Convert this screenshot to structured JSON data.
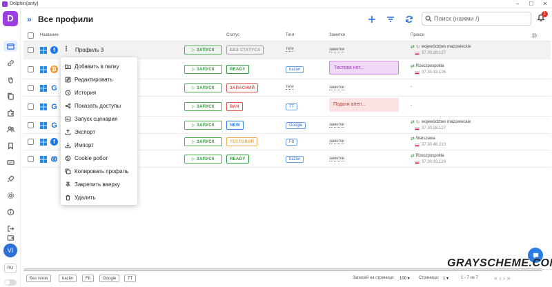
{
  "window": {
    "title": "Dolphin{anty}",
    "controls": [
      "–",
      "☐",
      "✕"
    ]
  },
  "sidebar": {
    "logo": "D",
    "avatar": "VI",
    "language": "RU"
  },
  "header": {
    "title": "Все профили",
    "search_placeholder": "Поиск (нажми /)",
    "notifications": "1"
  },
  "columns": {
    "name": "Название",
    "status": "Статус",
    "tags": "Теги",
    "notes": "Заметки",
    "proxy": "Прокси"
  },
  "launch_label": "▷ ЗАПУСК",
  "rows": [
    {
      "name": "Профиль 3",
      "browser": "f",
      "status": "БЕЗ СТАТУСА",
      "status_color": "#9e9e9e",
      "tag": "теги",
      "tag_style": "dotted",
      "note": "заметки",
      "note_style": "dotted",
      "proxy_region": "województwo mazowieckie",
      "proxy_ip": "37.30.28.127"
    },
    {
      "name": "",
      "browser": "B",
      "status": "READY",
      "status_color": "#2e9b3a",
      "tag": "bazier",
      "tag_style": "boxed",
      "note": "Тестова нот...",
      "note_style": "purple",
      "proxy_region": "Rzeczpospolita",
      "proxy_ip": "37.30.33.126"
    },
    {
      "name": "",
      "browser": "G",
      "status": "ЗАПАСНИЙ",
      "status_color": "#d9534f",
      "tag": "теги",
      "tag_style": "dotted",
      "note": "заметки",
      "note_style": "dotted",
      "proxy_region": "-",
      "proxy_ip": ""
    },
    {
      "name": "",
      "browser": "G",
      "status": "BAN",
      "status_color": "#d9534f",
      "tag": "TT",
      "tag_style": "boxed",
      "note": "Подати апел...",
      "note_style": "red",
      "proxy_region": "-",
      "proxy_ip": ""
    },
    {
      "name": "",
      "browser": "G",
      "status": "NEW",
      "status_color": "#2a7be4",
      "tag": "Google",
      "tag_style": "boxed",
      "note": "заметки",
      "note_style": "dotted",
      "proxy_region": "województwo mazowieckie",
      "proxy_ip": "37.30.28.127"
    },
    {
      "name": "",
      "browser": "f",
      "status": "ТЕСТОВИЙ",
      "status_color": "#f0ad4e",
      "tag": "Fb",
      "tag_style": "boxed",
      "note": "заметки",
      "note_style": "dotted",
      "proxy_region": "Warszawa",
      "proxy_ip": "37.30.48.210"
    },
    {
      "name": "",
      "browser": "globe",
      "status": "READY",
      "status_color": "#2e9b3a",
      "tag": "bazier",
      "tag_style": "boxed",
      "note": "заметки",
      "note_style": "dotted",
      "proxy_region": "Rzeczpospolita",
      "proxy_ip": "37.30.33.126"
    }
  ],
  "context_menu": [
    {
      "label": "Добавить в папку",
      "icon": "folder-plus-icon"
    },
    {
      "label": "Редактировать",
      "icon": "edit-icon"
    },
    {
      "label": "История",
      "icon": "history-icon"
    },
    {
      "label": "Показать доступы",
      "icon": "share-icon"
    },
    {
      "label": "Запуск сценария",
      "icon": "script-icon"
    },
    {
      "label": "Экспорт",
      "icon": "export-icon"
    },
    {
      "label": "Импорт",
      "icon": "import-icon"
    },
    {
      "label": "Cookie робот",
      "icon": "cookie-icon"
    },
    {
      "label": "Копировать профиль",
      "icon": "copy-icon"
    },
    {
      "label": "Закрепить вверху",
      "icon": "pin-icon"
    },
    {
      "label": "Удалить",
      "icon": "trash-icon"
    }
  ],
  "footer": {
    "tags": [
      "Без тегов",
      "bazier",
      "Fb",
      "Google",
      "TT"
    ],
    "per_page_label": "Записей на странице:",
    "per_page_value": "100 ▾",
    "page_label": "Страница:",
    "page_value": "1 ▾",
    "range": "1 - 7 из 7",
    "nav": "«  ‹  ›  »"
  },
  "watermark": "GRAYSCHEME.COM"
}
